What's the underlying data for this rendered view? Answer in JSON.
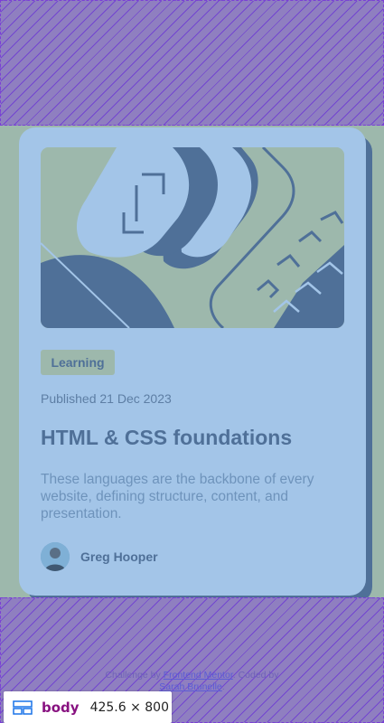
{
  "card": {
    "tag": "Learning",
    "published": "Published 21 Dec 2023",
    "title": "HTML & CSS foundations",
    "description": "These languages are the backbone of every website, defining structure, content, and presentation.",
    "author": "Greg Hooper"
  },
  "attribution": {
    "prefix": "Challenge by ",
    "link1": "Frontend Mentor",
    "middle": ". Coded by ",
    "link2": "Sarah Brunelle",
    "suffix": "."
  },
  "devtools": {
    "element": "body",
    "size": "425.6 × 800"
  },
  "colors": {
    "background": "#9db8ac",
    "card": "#a3c5e8",
    "card_shadow": "#4f7098",
    "overlay": "#8f7fc0",
    "text_dark": "#4f7098"
  },
  "icons": [
    "card-illustration",
    "avatar",
    "box-model-icon"
  ]
}
